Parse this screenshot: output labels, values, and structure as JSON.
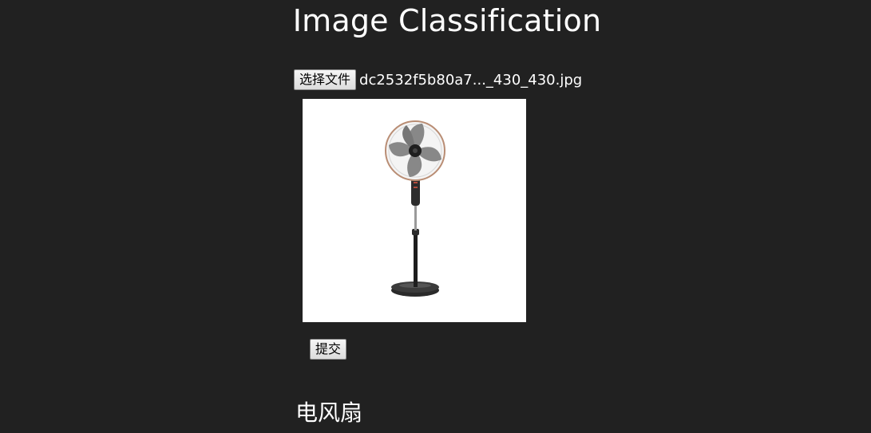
{
  "page": {
    "title": "Image Classification"
  },
  "upload": {
    "choose_button_label": "选择文件",
    "selected_file_name": "dc2532f5b80a7..._430_430.jpg"
  },
  "preview": {
    "image_icon": "standing-fan"
  },
  "form": {
    "submit_label": "提交"
  },
  "result": {
    "label": "电风扇"
  },
  "colors": {
    "background": "#212121",
    "text": "#ffffff",
    "preview_background": "#ffffff"
  }
}
